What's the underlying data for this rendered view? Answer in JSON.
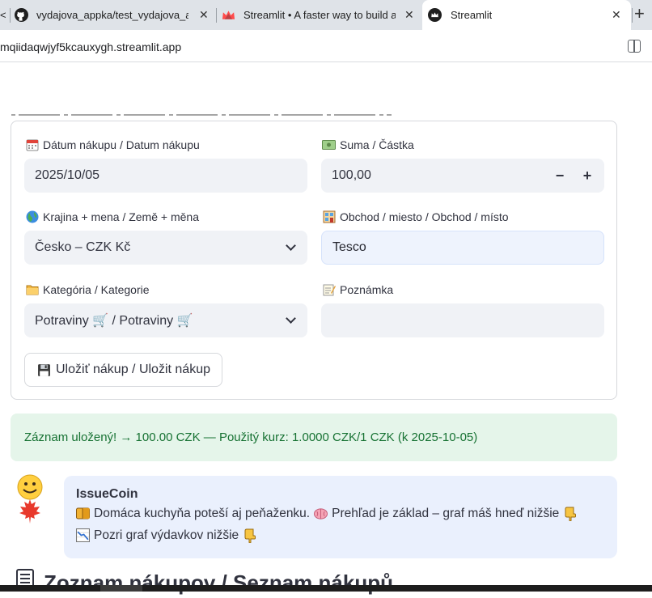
{
  "browser": {
    "tabs": [
      {
        "label": "vydajova_appka/test_vydajova_ap",
        "icon": "github-icon"
      },
      {
        "label": "Streamlit • A faster way to build a",
        "icon": "streamlit-icon"
      },
      {
        "label": "Streamlit",
        "icon": "streamlit-crown-icon",
        "active": true
      }
    ],
    "new_tab_label": "+",
    "url": "mqiidaqwjyf5kcauxygh.streamlit.app"
  },
  "form": {
    "date": {
      "label": "Dátum nákupu / Datum nákupu",
      "value": "2025/10/05"
    },
    "amount": {
      "label": "Suma / Částka",
      "value": "100,00",
      "minus": "−",
      "plus": "+"
    },
    "country": {
      "label": "Krajina + mena / Země + měna",
      "value": "Česko – CZK Kč"
    },
    "shop": {
      "label": "Obchod / miesto / Obchod / místo",
      "value": "Tesco"
    },
    "category": {
      "label": "Kategória / Kategorie",
      "value": "Potraviny 🛒 / Potraviny 🛒"
    },
    "note": {
      "label": "Poznámka",
      "value": ""
    },
    "save_button": "Uložiť nákup / Uložit nákup"
  },
  "success_message": "Záznam uložený! → 100.00 CZK — Použitý kurz: 1.0000 CZK/1 CZK (k 2025-10-05)",
  "chat": {
    "name": "IssueCoin",
    "line1_a": "Domáca kuchyňa poteší aj peňaženku.",
    "line1_b": "Prehľad je základ – graf máš hneď nižšie",
    "line2": "Pozri graf výdavkov nižšie"
  },
  "section_title": "Zoznam nákupov / Seznam nákupů",
  "colors": {
    "input_bg": "#f0f2f6",
    "success_bg": "#e5f5ea",
    "success_text": "#177233",
    "chat_bg": "#eaf0fd"
  }
}
